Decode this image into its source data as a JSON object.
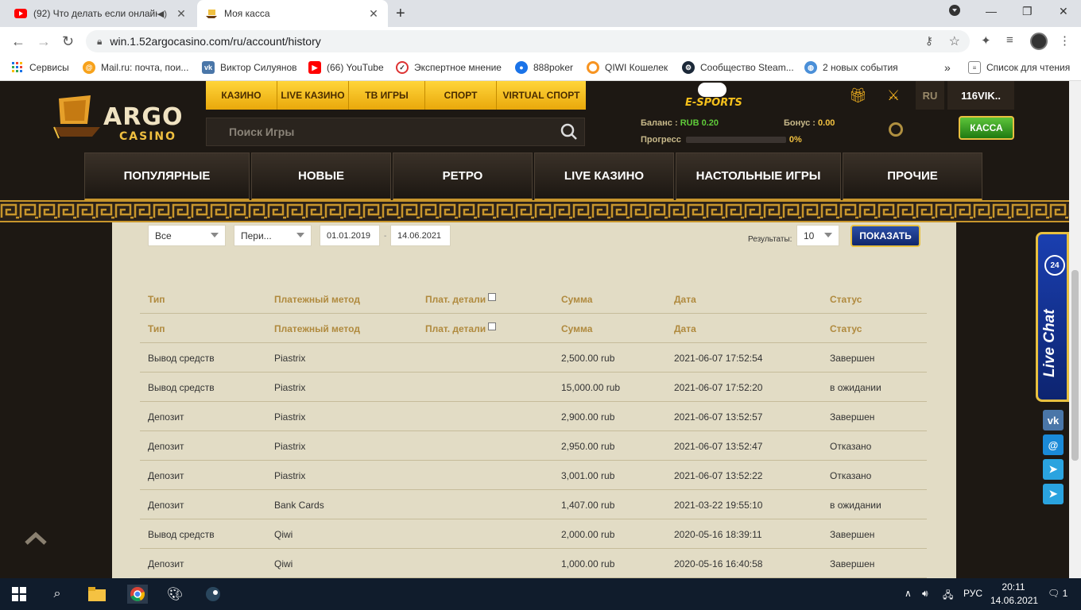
{
  "browser": {
    "tabs": [
      {
        "title": "(92) Что делать если онлайн",
        "active": false
      },
      {
        "title": "Моя касса",
        "active": true
      }
    ],
    "url": "win.1.52argocasino.com/ru/account/history",
    "bookmarks": [
      {
        "label": "Сервисы",
        "icon": "apps-icon"
      },
      {
        "label": "Mail.ru: почта, пои...",
        "icon": "mailru-icon"
      },
      {
        "label": "Виктор Силуянов",
        "icon": "vk-icon"
      },
      {
        "label": "(66) YouTube",
        "icon": "youtube-icon"
      },
      {
        "label": "Экспертное мнение",
        "icon": "expert-icon"
      },
      {
        "label": "888poker",
        "icon": "poker-icon"
      },
      {
        "label": "QIWI Кошелек",
        "icon": "qiwi-icon"
      },
      {
        "label": "Сообщество Steam...",
        "icon": "steam-icon"
      },
      {
        "label": "2 новых события",
        "icon": "globe-icon"
      }
    ],
    "more_bookmarks": "»",
    "reading_list": "Список для чтения"
  },
  "site": {
    "logo": {
      "argo": "ARGO",
      "casino": "CASINO"
    },
    "top_nav": [
      "КАЗИНО",
      "LIVE КАЗИНО",
      "ТВ ИГРЫ",
      "СПОРТ",
      "VIRTUAL СПОРТ"
    ],
    "esports": "E-SPORTS",
    "lang": "RU",
    "username": "116VIK..",
    "search_placeholder": "Поиск Игры",
    "balance_label": "Баланс :",
    "balance_value": "RUB 0.20",
    "bonus_label": "Бонус :",
    "bonus_value": "0.00",
    "progress_label": "Прогресс",
    "progress_value": "0%",
    "progress_fraction": 0,
    "kassa": "КАССА",
    "categories": [
      "ПОПУЛЯРНЫЕ",
      "НОВЫЕ",
      "РЕТРО",
      "LIVE КАЗИНО",
      "НАСТОЛЬНЫЕ ИГРЫ",
      "ПРОЧИЕ"
    ]
  },
  "history": {
    "filters": {
      "type": "Все",
      "period": "Пери...",
      "date_from": "01.01.2019",
      "date_sep": "-",
      "date_to": "14.06.2021",
      "results_label": "Результаты:",
      "results_value": "10",
      "show_button": "ПОКАЗАТЬ"
    },
    "columns": [
      "Тип",
      "Платежный метод",
      "Плат. детали",
      "Сумма",
      "Дата",
      "Статус"
    ],
    "rows": [
      [
        "Вывод средств",
        "Piastrix",
        "",
        "2,500.00 rub",
        "2021-06-07 17:52:54",
        "Завершен"
      ],
      [
        "Вывод средств",
        "Piastrix",
        "",
        "15,000.00 rub",
        "2021-06-07 17:52:20",
        "в ожидании"
      ],
      [
        "Депозит",
        "Piastrix",
        "",
        "2,900.00 rub",
        "2021-06-07 13:52:57",
        "Завершен"
      ],
      [
        "Депозит",
        "Piastrix",
        "",
        "2,950.00 rub",
        "2021-06-07 13:52:47",
        "Отказано"
      ],
      [
        "Депозит",
        "Piastrix",
        "",
        "3,001.00 rub",
        "2021-06-07 13:52:22",
        "Отказано"
      ],
      [
        "Депозит",
        "Bank Cards",
        "",
        "1,407.00 rub",
        "2021-03-22 19:55:10",
        "в ожидании"
      ],
      [
        "Вывод средств",
        "Qiwi",
        "",
        "2,000.00 rub",
        "2020-05-16 18:39:11",
        "Завершен"
      ],
      [
        "Депозит",
        "Qiwi",
        "",
        "1,000.00 rub",
        "2020-05-16 16:40:58",
        "Завершен"
      ]
    ]
  },
  "widgets": {
    "live_chat": "Live Chat",
    "badge": "24"
  },
  "taskbar": {
    "lang": "РУС",
    "time": "20:11",
    "date": "14.06.2021",
    "notifications": "1"
  }
}
